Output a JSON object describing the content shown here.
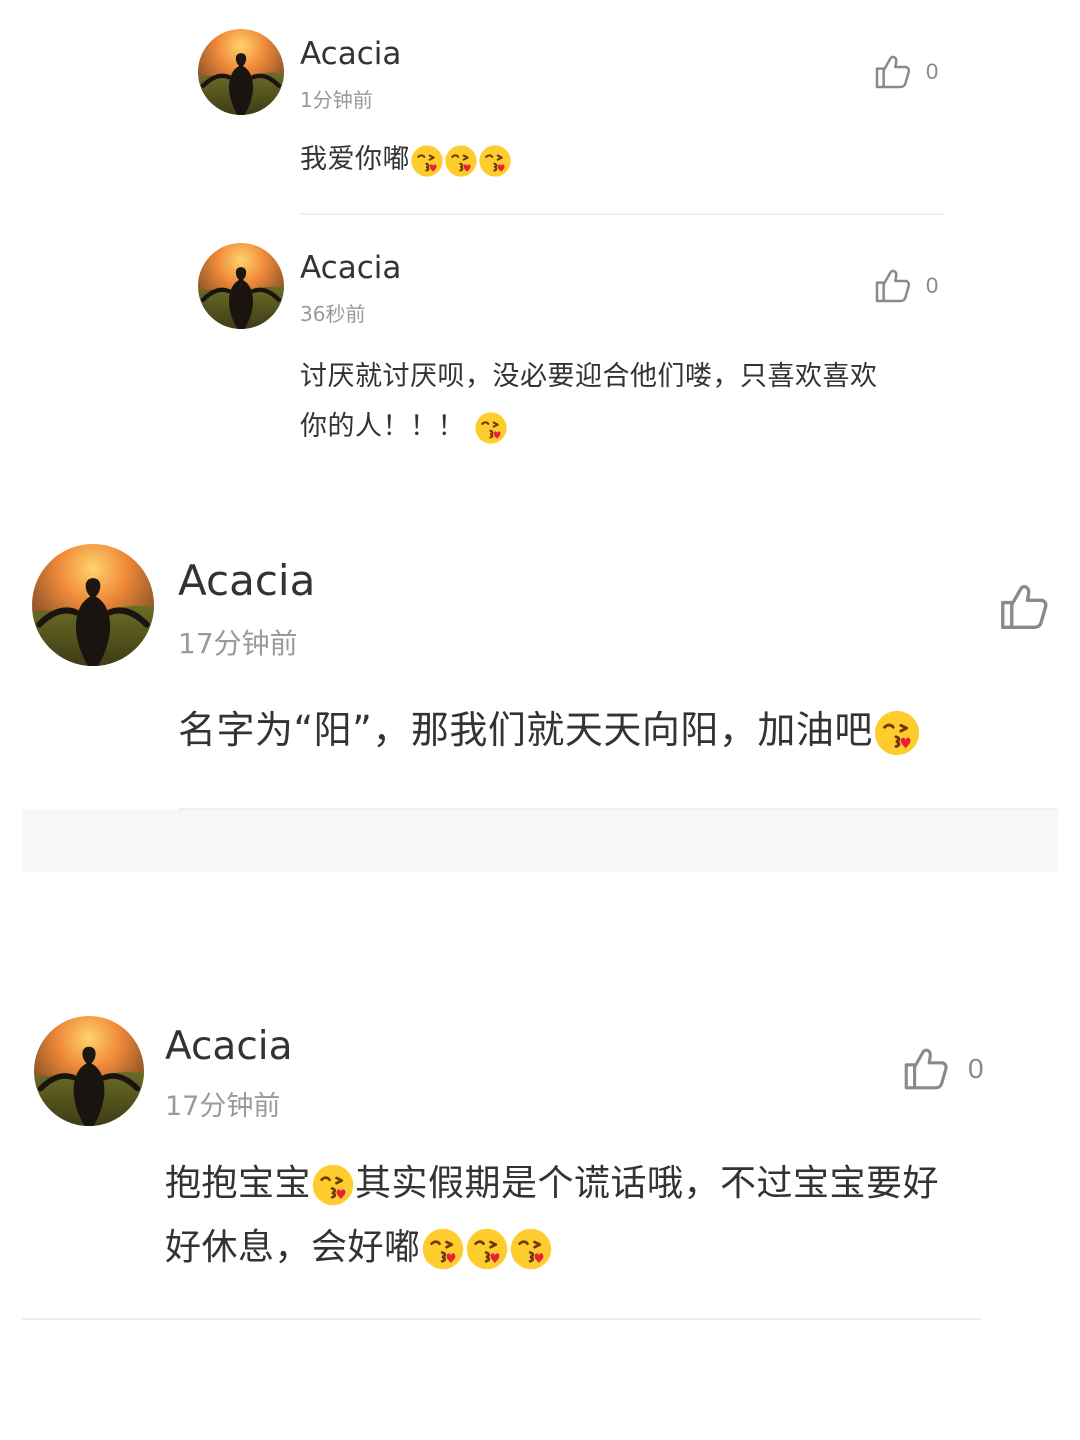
{
  "comments": [
    {
      "username": "Acacia",
      "time": "1分钟前",
      "likes": "0",
      "text_parts": [
        "我爱你嘟",
        "😘",
        "😘",
        "😘"
      ]
    },
    {
      "username": "Acacia",
      "time": "36秒前",
      "likes": "0",
      "text_parts": [
        "讨厌就讨厌呗，没必要迎合他们喽，只喜欢喜欢你的人！！！",
        "😘"
      ]
    },
    {
      "username": "Acacia",
      "time": "17分钟前",
      "likes": "",
      "text_parts": [
        "名字为“阳”，那我们就天天向阳，加油吧",
        "😘"
      ]
    },
    {
      "username": "Acacia",
      "time": "17分钟前",
      "likes": "0",
      "text_parts": [
        "抱抱宝宝",
        "😘",
        "其实假期是个谎话哦，不过宝宝要好好休息，会好嘟",
        "😘",
        "😘",
        "😘"
      ]
    }
  ],
  "icons": {
    "like": "thumbs-up-icon",
    "emoji": "kissing-face-emoji"
  },
  "colors": {
    "text": "#333333",
    "meta": "#9a9a9a",
    "divider": "#f0f0f0",
    "band": "#f7f7f7"
  }
}
